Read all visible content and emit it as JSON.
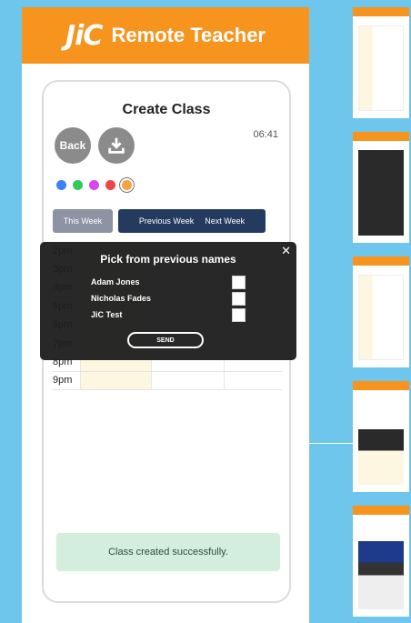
{
  "header": {
    "logo": "JiC",
    "title": "Remote Teacher"
  },
  "page": {
    "title": "Create Class",
    "time": "06:41",
    "back_label": "Back"
  },
  "colors": {
    "brand": "#f7941d",
    "dots": [
      "#3b82f6",
      "#34c759",
      "#d946ef",
      "#ef4444",
      "#f5a33a"
    ]
  },
  "week_nav": {
    "this_week": "This Week",
    "previous_week": "Previous Week",
    "next_week": "Next Week"
  },
  "schedule": {
    "hours": [
      "2pm",
      "3pm",
      "4pm",
      "5pm",
      "6pm",
      "7pm",
      "8pm",
      "9pm"
    ]
  },
  "status": {
    "message": "Class created successfully."
  },
  "modal": {
    "title": "Pick from previous names",
    "names": [
      "Adam Jones",
      "Nicholas Fades",
      "JiC Test"
    ],
    "send_label": "SEND"
  }
}
